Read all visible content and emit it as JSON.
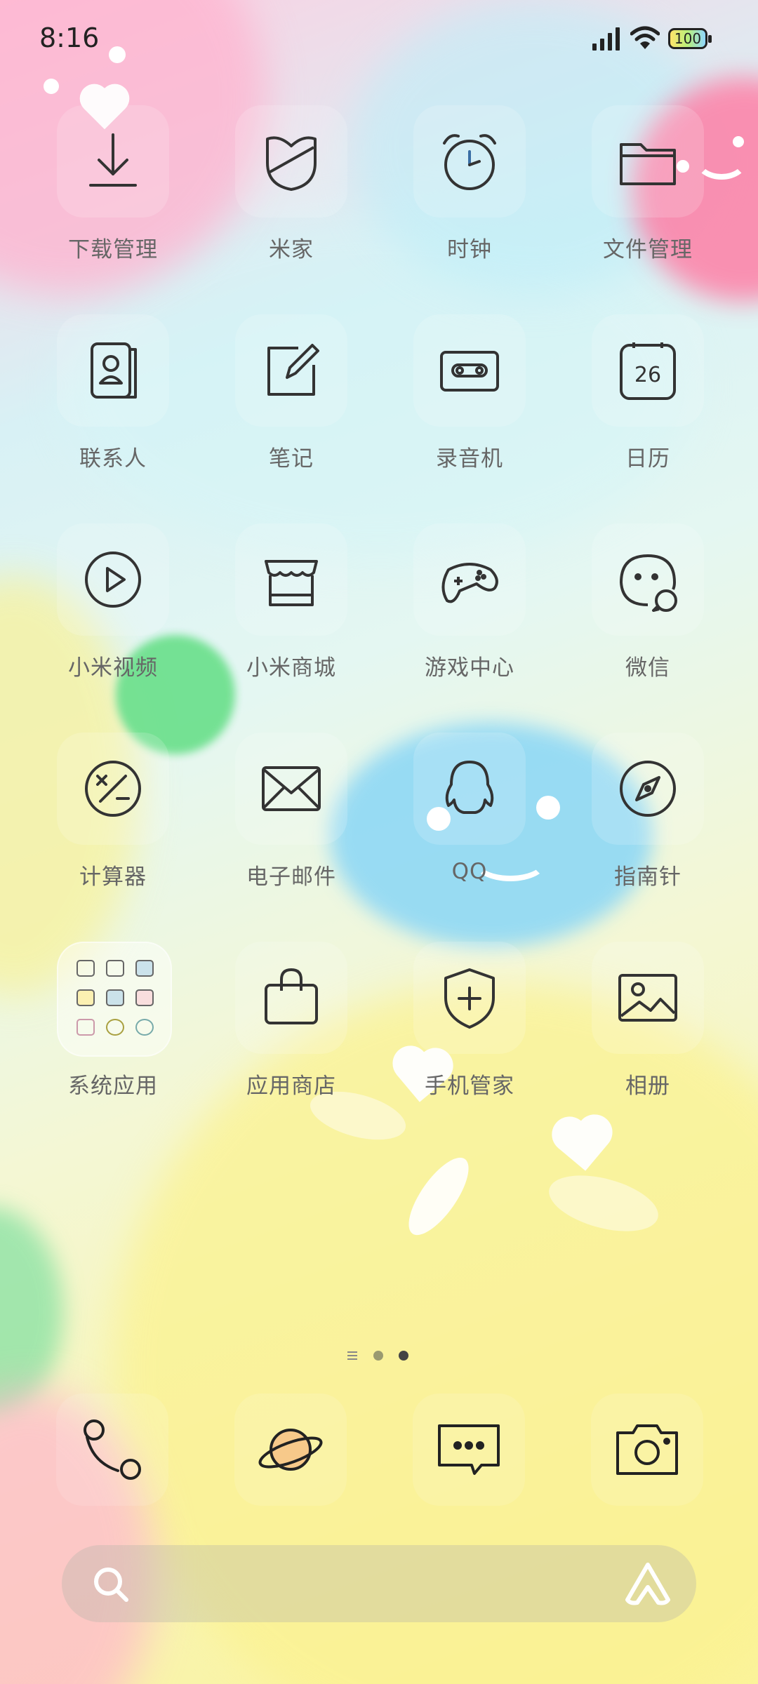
{
  "status_bar": {
    "time": "8:16",
    "battery": "100"
  },
  "apps": [
    {
      "label": "下载管理",
      "icon": "download-icon"
    },
    {
      "label": "米家",
      "icon": "mijia-icon"
    },
    {
      "label": "时钟",
      "icon": "alarm-clock-icon"
    },
    {
      "label": "文件管理",
      "icon": "folder-icon"
    },
    {
      "label": "联系人",
      "icon": "contacts-icon"
    },
    {
      "label": "笔记",
      "icon": "notes-icon"
    },
    {
      "label": "录音机",
      "icon": "cassette-icon"
    },
    {
      "label": "日历",
      "icon": "calendar-icon",
      "badge": "26"
    },
    {
      "label": "小米视频",
      "icon": "play-icon"
    },
    {
      "label": "小米商城",
      "icon": "store-icon"
    },
    {
      "label": "游戏中心",
      "icon": "gamepad-icon"
    },
    {
      "label": "微信",
      "icon": "wechat-icon"
    },
    {
      "label": "计算器",
      "icon": "calculator-icon"
    },
    {
      "label": "电子邮件",
      "icon": "mail-icon"
    },
    {
      "label": "QQ",
      "icon": "qq-penguin-icon"
    },
    {
      "label": "指南针",
      "icon": "compass-icon"
    },
    {
      "label": "系统应用",
      "icon": "folder-grid-icon"
    },
    {
      "label": "应用商店",
      "icon": "shopping-bag-icon"
    },
    {
      "label": "手机管家",
      "icon": "shield-plus-icon"
    },
    {
      "label": "相册",
      "icon": "photo-icon"
    }
  ],
  "pager": {
    "pages": 3,
    "current": 3
  },
  "dock": [
    {
      "icon": "phone-icon"
    },
    {
      "icon": "planet-browser-icon"
    },
    {
      "icon": "message-icon"
    },
    {
      "icon": "camera-icon"
    }
  ],
  "search": {
    "icon": "search-icon",
    "assistant_icon": "xiaoai-icon"
  }
}
